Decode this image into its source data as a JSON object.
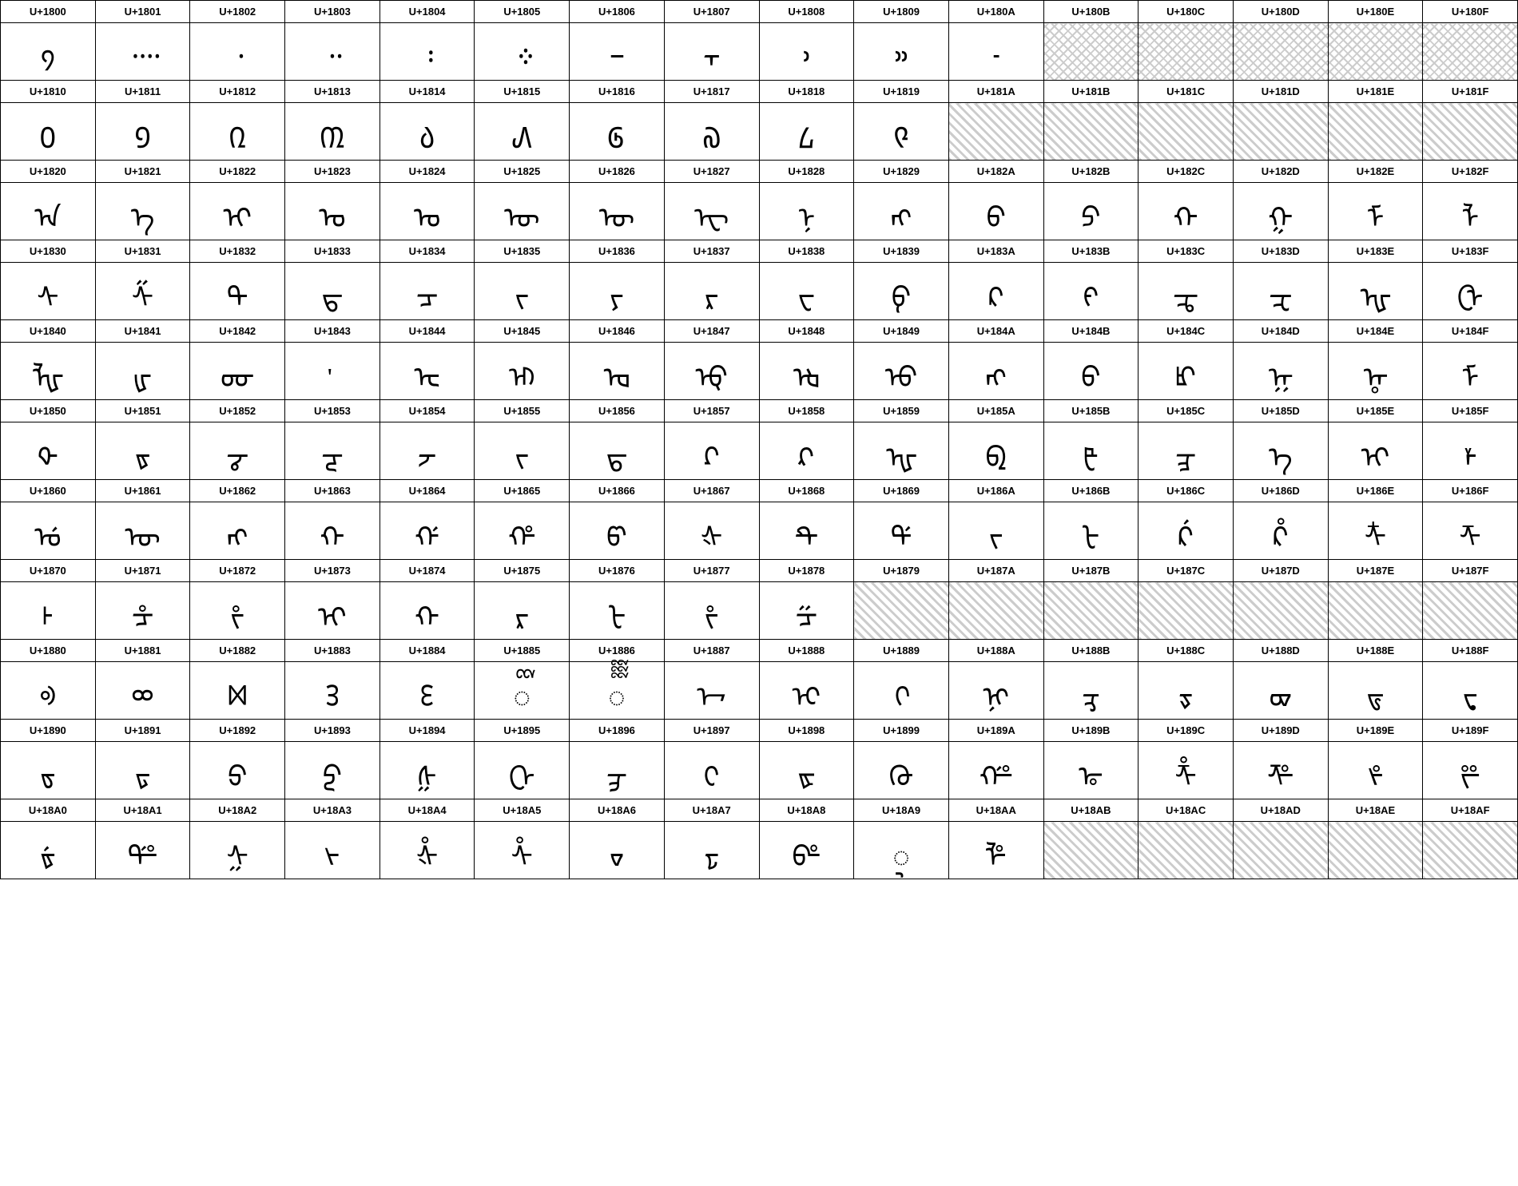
{
  "rows": [
    {
      "headers": [
        "U+1800",
        "U+1801",
        "U+1802",
        "U+1803",
        "U+1804",
        "U+1805",
        "U+1806",
        "U+1807",
        "U+1808",
        "U+1809",
        "U+180A",
        "U+180B",
        "U+180C",
        "U+180D",
        "U+180E",
        "U+180F"
      ],
      "chars": [
        "᠀",
        "᠁",
        "᠂",
        "᠃",
        "᠄",
        "᠅",
        "᠆",
        "᠇",
        "᠈",
        "᠉",
        "᠊",
        "na-cross",
        "na-cross",
        "na-cross",
        "na-cross",
        "na-cross"
      ]
    },
    {
      "headers": [
        "U+1810",
        "U+1811",
        "U+1812",
        "U+1813",
        "U+1814",
        "U+1815",
        "U+1816",
        "U+1817",
        "U+1818",
        "U+1819",
        "U+181A",
        "U+181B",
        "U+181C",
        "U+181D",
        "U+181E",
        "U+181F"
      ],
      "chars": [
        "᠐",
        "᠑",
        "᠒",
        "᠓",
        "᠔",
        "᠕",
        "᠖",
        "᠗",
        "᠘",
        "᠙",
        "na",
        "na",
        "na",
        "na",
        "na",
        "na"
      ]
    },
    {
      "headers": [
        "U+1820",
        "U+1821",
        "U+1822",
        "U+1823",
        "U+1824",
        "U+1825",
        "U+1826",
        "U+1827",
        "U+1828",
        "U+1829",
        "U+182A",
        "U+182B",
        "U+182C",
        "U+182D",
        "U+182E",
        "U+182F"
      ],
      "chars": [
        "ᠠ",
        "ᠡ",
        "ᠢ",
        "ᠣ",
        "ᠤ",
        "ᠥ",
        "ᠦ",
        "ᠧ",
        "ᠨ",
        "ᠩ",
        "ᠪ",
        "ᠫ",
        "ᠬ",
        "ᠭ",
        "ᠮ",
        "ᠯ"
      ]
    },
    {
      "headers": [
        "U+1830",
        "U+1831",
        "U+1832",
        "U+1833",
        "U+1834",
        "U+1835",
        "U+1836",
        "U+1837",
        "U+1838",
        "U+1839",
        "U+183A",
        "U+183B",
        "U+183C",
        "U+183D",
        "U+183E",
        "U+183F"
      ],
      "chars": [
        "ᠰ",
        "ᠱ",
        "ᠲ",
        "ᠳ",
        "ᠴ",
        "ᠵ",
        "ᠶ",
        "ᠷ",
        "ᠸ",
        "ᠹ",
        "ᠺ",
        "ᠻ",
        "ᠼ",
        "ᠽ",
        "ᠾ",
        "ᠿ"
      ]
    },
    {
      "headers": [
        "U+1840",
        "U+1841",
        "U+1842",
        "U+1843",
        "U+1844",
        "U+1845",
        "U+1846",
        "U+1847",
        "U+1848",
        "U+1849",
        "U+184A",
        "U+184B",
        "U+184C",
        "U+184D",
        "U+184E",
        "U+184F"
      ],
      "chars": [
        "ᡀ",
        "ᡁ",
        "ᡂ",
        "ᡃ",
        "ᡄ",
        "ᡅ",
        "ᡆ",
        "ᡇ",
        "ᡈ",
        "ᡉ",
        "ᡊ",
        "ᡋ",
        "ᡌ",
        "ᡍ",
        "ᡎ",
        "ᡏ"
      ]
    },
    {
      "headers": [
        "U+1850",
        "U+1851",
        "U+1852",
        "U+1853",
        "U+1854",
        "U+1855",
        "U+1856",
        "U+1857",
        "U+1858",
        "U+1859",
        "U+185A",
        "U+185B",
        "U+185C",
        "U+185D",
        "U+185E",
        "U+185F"
      ],
      "chars": [
        "ᡐ",
        "ᡑ",
        "ᡒ",
        "ᡓ",
        "ᡔ",
        "ᡕ",
        "ᡖ",
        "ᡗ",
        "ᡘ",
        "ᡙ",
        "ᡚ",
        "ᡛ",
        "ᡜ",
        "ᡝ",
        "ᡞ",
        "ᡟ"
      ]
    },
    {
      "headers": [
        "U+1860",
        "U+1861",
        "U+1862",
        "U+1863",
        "U+1864",
        "U+1865",
        "U+1866",
        "U+1867",
        "U+1868",
        "U+1869",
        "U+186A",
        "U+186B",
        "U+186C",
        "U+186D",
        "U+186E",
        "U+186F"
      ],
      "chars": [
        "ᡠ",
        "ᡡ",
        "ᡢ",
        "ᡣ",
        "ᡤ",
        "ᡥ",
        "ᡦ",
        "ᡧ",
        "ᡨ",
        "ᡩ",
        "ᡪ",
        "ᡫ",
        "ᡬ",
        "ᡭ",
        "ᡮ",
        "ᡯ"
      ]
    },
    {
      "headers": [
        "U+1870",
        "U+1871",
        "U+1872",
        "U+1873",
        "U+1874",
        "U+1875",
        "U+1876",
        "U+1877",
        "U+1878",
        "U+1879",
        "U+187A",
        "U+187B",
        "U+187C",
        "U+187D",
        "U+187E",
        "U+187F"
      ],
      "chars": [
        "ᡰ",
        "ᡱ",
        "ᡲ",
        "ᡳ",
        "ᡴ",
        "ᡵ",
        "ᡶ",
        "ᡷ",
        "ᡸ",
        "na",
        "na-diag",
        "na-diag",
        "na-diag",
        "na-diag",
        "na-diag",
        "na-diag"
      ]
    },
    {
      "headers": [
        "U+1880",
        "U+1881",
        "U+1882",
        "U+1883",
        "U+1884",
        "U+1885",
        "U+1886",
        "U+1887",
        "U+1888",
        "U+1889",
        "U+188A",
        "U+188B",
        "U+188C",
        "U+188D",
        "U+188E",
        "U+188F"
      ],
      "chars": [
        "ᢀ",
        "ᢁ",
        "ᢂ",
        "ᢃ",
        "ᢄ",
        "ᢅ",
        "ᢆ",
        "ᢇ",
        "ᢈ",
        "ᢉ",
        "ᢊ",
        "ᢋ",
        "ᢌ",
        "ᢍ",
        "ᢎ",
        "ᢏ"
      ]
    },
    {
      "headers": [
        "U+1890",
        "U+1891",
        "U+1892",
        "U+1893",
        "U+1894",
        "U+1895",
        "U+1896",
        "U+1897",
        "U+1898",
        "U+1899",
        "U+189A",
        "U+189B",
        "U+189C",
        "U+189D",
        "U+189E",
        "U+189F"
      ],
      "chars": [
        "ᢐ",
        "ᢑ",
        "ᢒ",
        "ᢓ",
        "ᢔ",
        "ᢕ",
        "ᢖ",
        "ᢗ",
        "ᢘ",
        "ᢙ",
        "ᢚ",
        "ᢛ",
        "ᢜ",
        "ᢝ",
        "ᢞ",
        "ᢟ"
      ]
    },
    {
      "headers": [
        "U+18A0",
        "U+18A1",
        "U+18A2",
        "U+18A3",
        "U+18A4",
        "U+18A5",
        "U+18A6",
        "U+18A7",
        "U+18A8",
        "U+18A9",
        "U+18AA",
        "U+18AB",
        "U+18AC",
        "U+18AD",
        "U+18AE",
        "U+18AF"
      ],
      "chars": [
        "ᢠ",
        "ᢡ",
        "ᢢ",
        "ᢣ",
        "ᢤ",
        "ᢥ",
        "ᢦ",
        "ᢧ",
        "ᢨ",
        "ᢩ",
        "ᢪ",
        "na",
        "na",
        "na",
        "na",
        "na"
      ]
    }
  ]
}
